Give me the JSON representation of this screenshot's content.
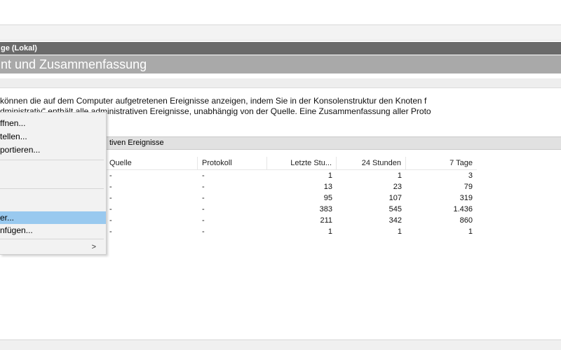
{
  "header": {
    "title_dark": "ge (Lokal)",
    "title_mid": "nt und Zusammenfassung"
  },
  "description": {
    "line1": "können die auf dem Computer aufgetretenen Ereignisse anzeigen, indem Sie in der Konsolenstruktur den Knoten f",
    "line2": "dministrativ\" enthält alle administrativen Ereignisse, unabhängig von der Quelle. Eine Zusammenfassung aller Proto"
  },
  "section": {
    "title": "tiven Ereignisse"
  },
  "table": {
    "columns": [
      "Quelle",
      "Protokoll",
      "Letzte Stu...",
      "24 Stunden",
      "7 Tage"
    ],
    "rows": [
      [
        "-",
        "-",
        "1",
        "1",
        "3"
      ],
      [
        "-",
        "-",
        "13",
        "23",
        "79"
      ],
      [
        "-",
        "-",
        "95",
        "107",
        "319"
      ],
      [
        "-",
        "-",
        "383",
        "545",
        "1.436"
      ],
      [
        "-",
        "-",
        "211",
        "342",
        "860"
      ],
      [
        "-",
        "-",
        "1",
        "1",
        "1"
      ]
    ]
  },
  "context_menu": {
    "item_open": "ffnen...",
    "item_create": "tellen...",
    "item_import": "portieren...",
    "item_selected": "er...",
    "item_add": "nfügen...",
    "submenu_arrow": ">"
  },
  "colors": {
    "header_dark": "#6a6a6a",
    "header_mid": "#a9a9a9",
    "menu_selected": "#99c9ef",
    "section_bar": "#e1e1e1"
  }
}
